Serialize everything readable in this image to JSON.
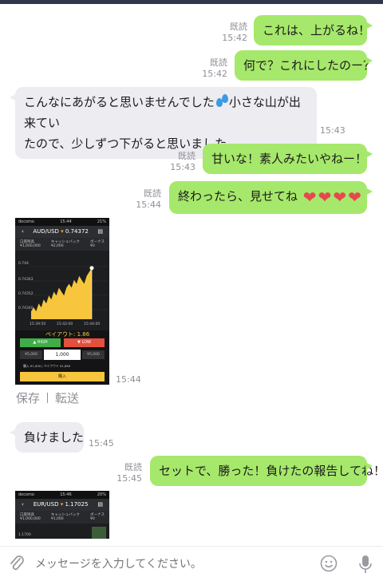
{
  "messages": {
    "m1": {
      "text": "これは、上がるね！",
      "read": "既読",
      "time": "15:42"
    },
    "m2": {
      "text": "何で？これにしたのー？",
      "read": "既読",
      "time": "15:42"
    },
    "m3": {
      "text_a": "こんなにあがると思いませんでした",
      "text_b": "小さな山が出来てい",
      "text_c": "たので、少しずつ下がると思いました。",
      "emoji": "sweat-droplets-icon",
      "time": "15:43"
    },
    "m4": {
      "text": "甘いな！素人みたいやねー！",
      "read": "既読",
      "time": "15:43"
    },
    "m5": {
      "text": "終わったら、見せてね",
      "read": "既読",
      "time": "15:44",
      "heart_count": 4,
      "heart_color": "#e5494f"
    },
    "m6": {
      "time": "15:44"
    },
    "m7": {
      "text": "負けました",
      "time": "15:45"
    },
    "m8": {
      "text": "セットで、勝った！負けたの報告してね！",
      "read": "既読",
      "time": "15:45"
    }
  },
  "image_actions": {
    "save": "保存",
    "forward": "転送"
  },
  "shot1": {
    "carrier": "docomo",
    "clock": "15:44",
    "battery": "21%",
    "pair": "AUD/USD",
    "rate": "0.74372",
    "balance_label": "口座残高",
    "balance": "¥1,000,000",
    "cashback_label": "キャッシュバック",
    "cashback": "¥2,000",
    "bonus_label": "ボーナス",
    "bonus": "¥0",
    "prices": [
      "0.744",
      "0.74363",
      "0.74352",
      "0.74340"
    ],
    "times": [
      "15:39:50",
      "15:42:00",
      "15:44:00"
    ],
    "payout_label": "ペイアウト",
    "payout": "1.86",
    "high_label": "HIGH",
    "low_label": "LOW",
    "amount_minus": "¥5,000",
    "amount": "1,000",
    "amount_plus": "¥5,000",
    "summary": "購入 ¥1,000  |  ペイアウト ¥1,860",
    "buy_label": "購入",
    "series": [
      0.743,
      0.7431,
      0.743,
      0.7432,
      0.7431,
      0.7433,
      0.7432,
      0.7434,
      0.7433,
      0.7435,
      0.7434,
      0.7436,
      0.7435,
      0.7434,
      0.7436,
      0.7437,
      0.7436,
      0.7438,
      0.7437,
      0.7439,
      0.7438,
      0.7437,
      0.7439,
      0.744,
      0.7441
    ],
    "accent_color": "#f7c63c",
    "high_color": "#3fae49",
    "low_color": "#e44f3e"
  },
  "shot2": {
    "carrier": "docomo",
    "clock": "15:46",
    "battery": "20%",
    "pair": "EUR/USD",
    "rate": "1.17025",
    "balance_label": "口座残高",
    "balance": "¥1,000,000",
    "cashback_label": "キャッシュバック",
    "cashback": "¥1,000",
    "bonus_label": "ボーナス",
    "bonus": "¥0",
    "price": "1.1700"
  },
  "input": {
    "placeholder": "メッセージを入力してください。"
  }
}
